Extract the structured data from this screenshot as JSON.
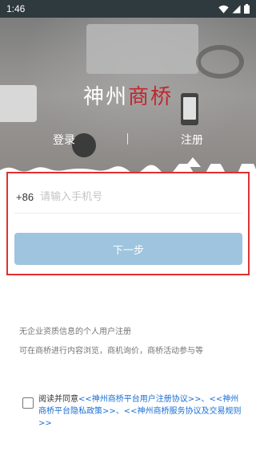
{
  "status_bar": {
    "time": "1:46",
    "icons": [
      "wifi-icon",
      "signal-icon",
      "battery-icon"
    ]
  },
  "header": {
    "logo_part1": "神州",
    "logo_part2": "商桥",
    "logo_colors": {
      "part1": "#ffffff",
      "part2": "#c0272d"
    },
    "tabs": [
      {
        "label": "登录",
        "active": false
      },
      {
        "label": "注册",
        "active": true
      }
    ]
  },
  "form": {
    "country_code": "+86",
    "phone_value": "",
    "phone_placeholder": "请输入手机号",
    "next_button_label": "下一步",
    "button_color": "#9ec4df",
    "highlight_border_color": "#e03030"
  },
  "info": {
    "line1": "无企业资质信息的个人用户注册",
    "line2": "可在商桥进行内容浏览，商机询价，商桥活动参与等"
  },
  "agreement": {
    "checked": false,
    "prefix": "阅读并同意",
    "link1": "<<神州商桥平台用户注册协议>>",
    "sep1": "、",
    "link2": "<<神州商桥平台隐私政策>>",
    "sep2": "、",
    "link3": "<<神州商桥服务协议及交易规则>>",
    "link_color": "#1a6fd3"
  }
}
